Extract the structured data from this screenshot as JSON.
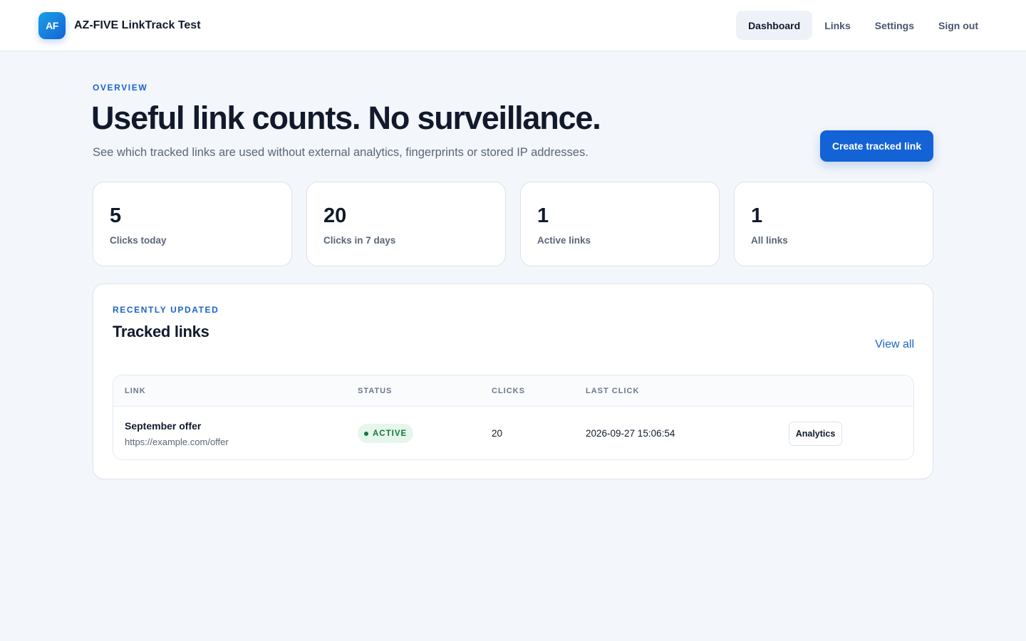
{
  "brand": {
    "logo_text": "AF",
    "name": "AZ-FIVE LinkTrack Test",
    "accent": "#1463d6"
  },
  "nav": {
    "items": [
      {
        "label": "Dashboard",
        "active": true
      },
      {
        "label": "Links",
        "active": false
      },
      {
        "label": "Settings",
        "active": false
      },
      {
        "label": "Sign out",
        "active": false
      }
    ]
  },
  "hero": {
    "eyebrow": "OVERVIEW",
    "title": "Useful link counts. No surveillance.",
    "subtitle": "See which tracked links are used without external analytics, fingerprints or stored IP addresses.",
    "cta_label": "Create tracked link"
  },
  "stats": [
    {
      "value": "5",
      "label": "Clicks today"
    },
    {
      "value": "20",
      "label": "Clicks in 7 days"
    },
    {
      "value": "1",
      "label": "Active links"
    },
    {
      "value": "1",
      "label": "All links"
    }
  ],
  "panel": {
    "eyebrow": "RECENTLY UPDATED",
    "title": "Tracked links",
    "view_all": "View all",
    "columns": {
      "link": "LINK",
      "status": "STATUS",
      "clicks": "CLICKS",
      "last_click": "LAST CLICK"
    },
    "rows": [
      {
        "name": "September offer",
        "url": "https://example.com/offer",
        "status": "ACTIVE",
        "status_color": "#137a3a",
        "clicks": "20",
        "last_click": "2026-09-27 15:06:54",
        "action": "Analytics"
      }
    ]
  }
}
